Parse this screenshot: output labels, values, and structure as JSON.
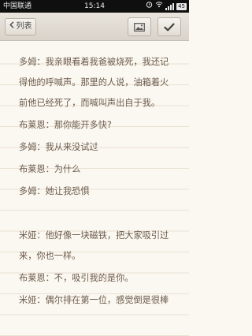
{
  "status_bar": {
    "carrier": "中国联通",
    "time": "15:14",
    "battery": "45"
  },
  "toolbar": {
    "back_label": "列表",
    "back_icon": "chevron-left-icon",
    "image_icon": "image-icon",
    "done_icon": "checkmark-icon"
  },
  "note": {
    "lines": [
      "多姆：我亲眼看着我爸被烧死，我还记",
      "得他的呼喊声。那里的人说，油箱着火",
      "前他已经死了，而喊叫声出自于我。",
      "布莱恩：那你能开多快?",
      "多姆：我从来没试过",
      "布莱恩：为什么",
      "多姆：她让我恐惧",
      "",
      "米娅：他好像一块磁铁，把大家吸引过",
      "来，你也一样。",
      "布莱恩：不，吸引我的是你。",
      "米娅：偶尔排在第一位，感觉倒是很棒"
    ]
  }
}
